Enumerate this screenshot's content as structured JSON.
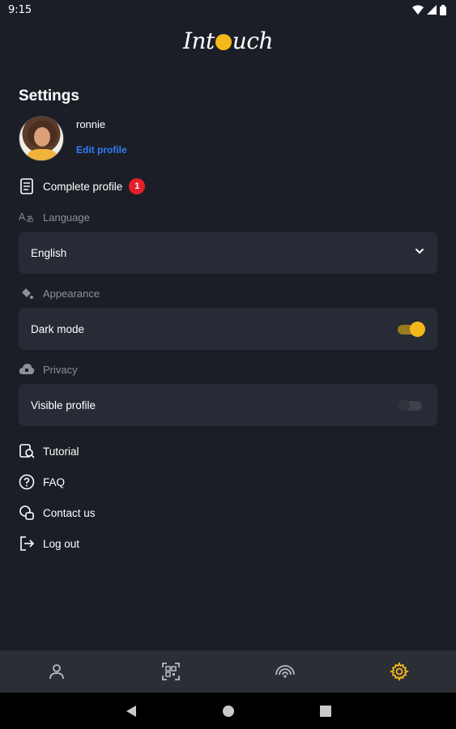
{
  "status_bar": {
    "time": "9:15"
  },
  "logo": {
    "text_left": "Int",
    "text_right": "uch"
  },
  "settings": {
    "title": "Settings",
    "profile": {
      "username": "ronnie",
      "edit_label": "Edit profile"
    },
    "complete_profile": {
      "label": "Complete profile",
      "badge": "1"
    },
    "language": {
      "section": "Language",
      "value": "English"
    },
    "appearance": {
      "section": "Appearance",
      "dark_mode_label": "Dark mode",
      "dark_mode_on": true
    },
    "privacy": {
      "section": "Privacy",
      "visible_profile_label": "Visible profile",
      "visible_profile_on": false
    },
    "links": {
      "tutorial": "Tutorial",
      "faq": "FAQ",
      "contact": "Contact us",
      "logout": "Log out"
    }
  },
  "bottom_nav": {
    "items": [
      "profile-icon",
      "qr-scan-icon",
      "wireless-icon",
      "settings-gear-icon"
    ],
    "active": "settings-gear-icon",
    "active_color": "#f5b81a",
    "inactive_color": "#b9bcc3"
  },
  "colors": {
    "accent": "#f5b81a",
    "link": "#2f7df4",
    "badge": "#e5202a",
    "background": "#1b1e26",
    "card": "#272b35"
  }
}
